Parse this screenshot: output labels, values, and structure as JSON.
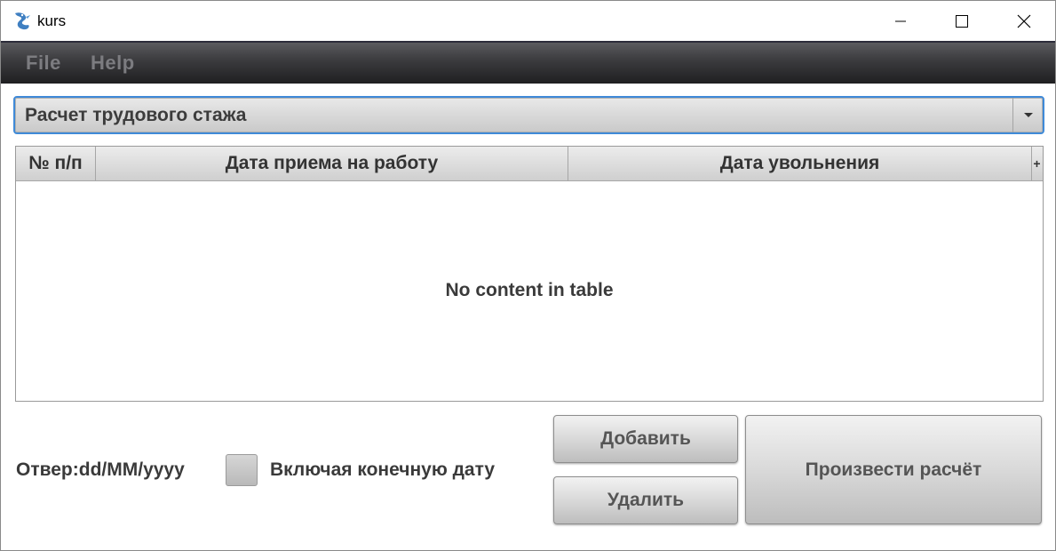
{
  "window": {
    "title": "kurs",
    "icon": "dragon-app-icon",
    "controls": {
      "minimize_icon": "minimize-icon",
      "maximize_icon": "maximize-icon",
      "close_icon": "close-icon"
    }
  },
  "menu": {
    "items": [
      {
        "label": "File"
      },
      {
        "label": "Help"
      }
    ]
  },
  "calc_type_select": {
    "selected": "Расчет трудового стажа",
    "icon": "chevron-down-icon"
  },
  "table": {
    "columns": [
      {
        "label": "№ п/п"
      },
      {
        "label": "Дата приема на работу"
      },
      {
        "label": "Дата увольнения"
      }
    ],
    "column_menu_button": "+",
    "empty_text": "No content in table"
  },
  "footer": {
    "date_format_label": "Отвер:dd/MM/yyyy",
    "include_end_date_checked": false,
    "include_end_date_label": "Включая конечную дату",
    "add_button": "Добавить",
    "delete_button": "Удалить",
    "calculate_button": "Произвести расчёт"
  },
  "colors": {
    "focus_border": "#3f8ad8",
    "menubar_dark": "#1f1f21",
    "menu_text": "#7c7c80"
  }
}
